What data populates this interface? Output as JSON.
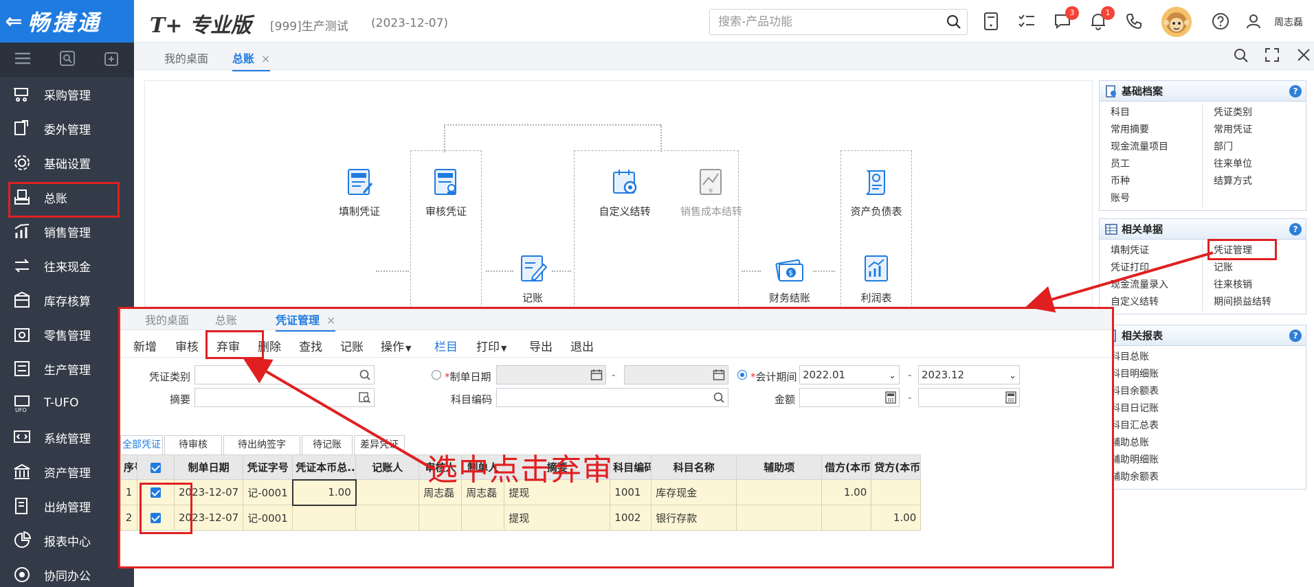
{
  "app": {
    "brand": "畅捷通",
    "product_prefix": "T+",
    "product_name": "专业版",
    "account": "[999]生产测试",
    "account_date": "(2023-12-07)",
    "search_placeholder": "搜索-产品功能",
    "badge_messages": "3",
    "badge_notifications": "1",
    "user": "周志磊"
  },
  "sidebar": {
    "items": [
      {
        "label": "采购管理",
        "icon": "purchase-icon"
      },
      {
        "label": "委外管理",
        "icon": "outsource-icon"
      },
      {
        "label": "基础设置",
        "icon": "settings-icon"
      },
      {
        "label": "总账",
        "icon": "ledger-icon"
      },
      {
        "label": "销售管理",
        "icon": "sales-icon"
      },
      {
        "label": "往来现金",
        "icon": "cash-icon"
      },
      {
        "label": "库存核算",
        "icon": "inventory-icon"
      },
      {
        "label": "零售管理",
        "icon": "retail-icon"
      },
      {
        "label": "生产管理",
        "icon": "production-icon"
      },
      {
        "label": "T-UFO",
        "icon": "ufo-icon"
      },
      {
        "label": "系统管理",
        "icon": "system-icon"
      },
      {
        "label": "资产管理",
        "icon": "asset-icon"
      },
      {
        "label": "出纳管理",
        "icon": "cashier-icon"
      },
      {
        "label": "报表中心",
        "icon": "report-icon"
      },
      {
        "label": "协同办公",
        "icon": "collab-icon"
      }
    ]
  },
  "outer_tabs": {
    "desktop": "我的桌面",
    "ledger": "总账",
    "close": "×"
  },
  "flow": {
    "fill_voucher": "填制凭证",
    "audit_voucher": "审核凭证",
    "custom_transfer": "自定义结转",
    "sales_cost_transfer": "销售成本结转",
    "balance_sheet": "资产负债表",
    "post": "记账",
    "period_close": "财务结账",
    "income_statement": "利润表"
  },
  "panels": {
    "basic": {
      "title": "基础档案",
      "left": [
        "科目",
        "常用摘要",
        "现金流量项目",
        "员工",
        "币种",
        "账号"
      ],
      "right": [
        "凭证类别",
        "常用凭证",
        "部门",
        "往来单位",
        "结算方式"
      ]
    },
    "docs": {
      "title": "相关单据",
      "left": [
        "填制凭证",
        "凭证打印",
        "现金流量录入",
        "自定义结转"
      ],
      "right": [
        "凭证管理",
        "记账",
        "往来核销",
        "期间损益结转"
      ]
    },
    "reports": {
      "title": "相关报表",
      "left": [
        "科目总账",
        "科目明细账",
        "科目余额表",
        "科目日记账",
        "科目汇总表",
        "辅助总账",
        "辅助明细账",
        "辅助余额表"
      ]
    }
  },
  "voucher": {
    "tabs": {
      "desktop": "我的桌面",
      "ledger": "总账",
      "manage": "凭证管理",
      "close": "×"
    },
    "toolbar": {
      "add": "新增",
      "audit": "审核",
      "unaudit": "弃审",
      "delete": "删除",
      "find": "查找",
      "post": "记账",
      "ops": "操作",
      "columns": "栏目",
      "print": "打印",
      "export": "导出",
      "exit": "退出"
    },
    "filters": {
      "type_label": "凭证类别",
      "summary_label": "摘要",
      "date_label": "制单日期",
      "account_code_label": "科目编码",
      "period_label": "会计期间",
      "period_from": "2022.01",
      "period_to": "2023.12",
      "amount_label": "金额",
      "dash": "-",
      "req": "*"
    },
    "status_tabs": [
      "全部凭证",
      "待审核",
      "待出纳签字",
      "待记账",
      "差异凭证"
    ],
    "columns": [
      "序号",
      "",
      "制单日期",
      "凭证字号",
      "凭证本币总...",
      "记账人",
      "审核人",
      "制单人",
      "摘要",
      "科目编码",
      "科目名称",
      "辅助项",
      "借方(本币)",
      "贷方(本币)"
    ],
    "rows": [
      {
        "no": "1",
        "date": "2023-12-07",
        "code": "记-0001",
        "total": "1.00",
        "poster": "",
        "auditor": "周志磊",
        "maker": "周志磊",
        "summary": "提现",
        "acct_code": "1001",
        "acct_name": "库存现金",
        "aux": "",
        "debit": "1.00",
        "credit": ""
      },
      {
        "no": "2",
        "date": "2023-12-07",
        "code": "记-0001",
        "total": "",
        "poster": "",
        "auditor": "",
        "maker": "",
        "summary": "提现",
        "acct_code": "1002",
        "acct_name": "银行存款",
        "aux": "",
        "debit": "",
        "credit": "1.00"
      }
    ]
  },
  "annotation": {
    "text": "选中点击弃审",
    "color": "#e02020"
  },
  "colors": {
    "brand_blue": "#1f7be0",
    "sidebar_bg": "#333b48",
    "row_highlight": "#fdf6d6"
  }
}
